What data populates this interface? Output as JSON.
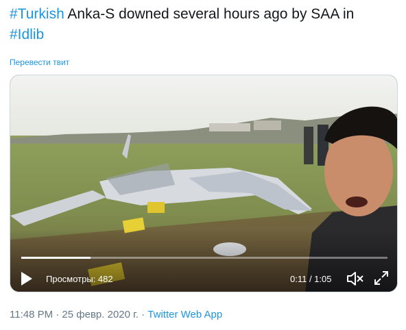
{
  "tweet": {
    "hashtag1": "#Turkish",
    "text1": " Anka-S downed several hours ago by SAA in",
    "hashtag2": "#Idlib",
    "translate": "Перевести твит"
  },
  "video": {
    "views_label": "Просмотры: 482",
    "time": "0:11 / 1:05",
    "progress": 0.19,
    "icons": [
      "play-icon",
      "mute-icon",
      "fullscreen-icon"
    ]
  },
  "meta": {
    "timestamp": "11:48 PM · 25 февр. 2020 г. · ",
    "source": "Twitter Web App"
  },
  "colors": {
    "link": "#1b95e0",
    "text": "#14171a",
    "muted": "#657786"
  }
}
